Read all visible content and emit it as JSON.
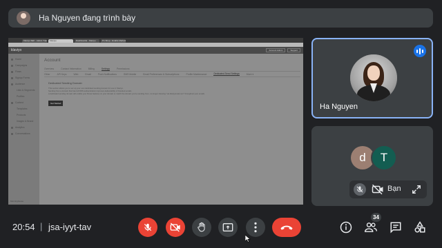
{
  "presenter_banner": {
    "text": "Ha Nguyen đang trình bày"
  },
  "shared_screen": {
    "browser_tabs": [
      "Klaviyo SEF · Admin Training",
      "Klaviyo",
      "Dashboards · Klaviyo",
      "Pn Shop · Enable Marketing"
    ],
    "app": {
      "logo": "klaviyo",
      "top_buttons": [
        "Account Admin",
        "Support"
      ],
      "sidebar": [
        "Home",
        "Campaigns",
        "Flows",
        "Signup Forms",
        "Audience",
        "Lists & Segments",
        "Profiles",
        "Content",
        "Templates",
        "Products",
        "Images & Brand",
        "Analytics",
        "Conversations"
      ],
      "sidebar_sub_indexes": [
        5,
        6,
        8,
        9,
        10
      ],
      "sidebar_footer": "Morninghouse",
      "title": "Account",
      "tabs_row1": [
        "Overview",
        "Contact Information",
        "Billing",
        "Settings",
        "Permissions"
      ],
      "selected_row1": "Settings",
      "tabs_row2": [
        "Other",
        "API Keys",
        "Web",
        "Email",
        "Push Notifications",
        "SMS Mobile",
        "Email Preferences & Subscriptions",
        "Profile Maintenance",
        "Dedicated Send Settings",
        "More ▾"
      ],
      "selected_row2": "Dedicated Send Settings",
      "section_heading": "Dedicated Sending Domain",
      "section_lines": [
        "This section allows you to set up your own dedicated sending domain for use in Klaviyo.",
        "Sending from a domain that has full DNS authentication improves deliverability of branded emails.",
        "A dedicated sending domain will enable your Flows features on your domain to match the domain you're sending from, no longer showing \"via klaviyomail.com\" throughout your emails."
      ],
      "cta_label": "Get Started"
    }
  },
  "participants": {
    "main_tile": {
      "name": "Ha Nguyen",
      "speaking": true,
      "highlight_color": "#8ab4f8"
    },
    "self_tile": {
      "avatars": [
        {
          "letter": "d",
          "color": "#9c7f72"
        },
        {
          "letter": "T",
          "color": "#135d51"
        }
      ],
      "name": "Bạn",
      "mic_muted": true,
      "camera_off": true
    }
  },
  "bottom_bar": {
    "time": "20:54",
    "separator": "|",
    "meeting_code": "jsa-iyyt-tav",
    "controls": [
      "mic-off-icon",
      "camera-off-icon",
      "raise-hand-icon",
      "present-icon",
      "more-icon",
      "end-call-icon"
    ],
    "people_count": "34",
    "right_icons": [
      "info-icon",
      "people-icon",
      "chat-icon",
      "activities-icon"
    ],
    "accent_red": "#ea4335"
  }
}
